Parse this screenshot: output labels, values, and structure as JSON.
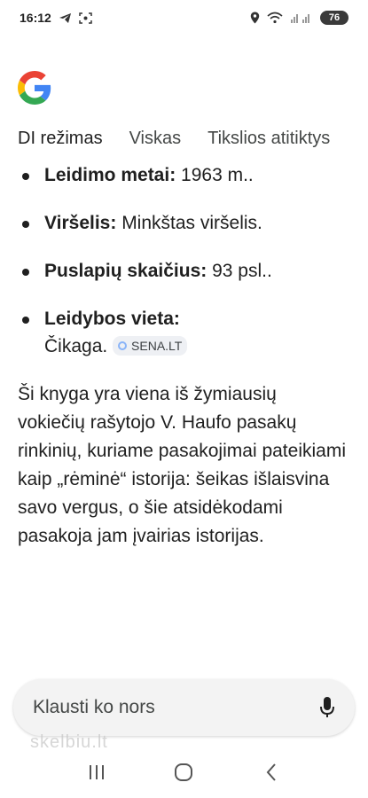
{
  "status_bar": {
    "time": "16:12",
    "battery": "76",
    "icons": [
      "telegram-icon",
      "screenshot-icon",
      "location-icon",
      "wifi-icon",
      "signal-icon",
      "battery-icon"
    ]
  },
  "app": {
    "logo": "google-logo"
  },
  "tabs": [
    {
      "label": "DI režimas",
      "active": true
    },
    {
      "label": "Viskas",
      "active": false
    },
    {
      "label": "Tikslios atitiktys",
      "active": false
    }
  ],
  "details": [
    {
      "label": "Leidimo metai:",
      "value": "1963 m.."
    },
    {
      "label": "Viršelis:",
      "value": "Minkštas viršelis."
    },
    {
      "label": "Puslapių skaičius:",
      "value": "93 psl.."
    },
    {
      "label": "Leidybos vieta:",
      "value": "Čikaga.",
      "source_chip": "SENA.LT"
    }
  ],
  "paragraph": "Ši knyga yra viena iš žymiausių vokiečių rašytojo V. Haufo pasakų rinkinių, kuriame pasakojimai pateikiami kaip „rėminė“ istorija: šeikas išlaisvina savo vergus, o šie atsidėkodami pasakoja jam įvairias istorijas.",
  "ask_bar": {
    "placeholder": "Klausti ko nors",
    "icon": "mic-icon"
  },
  "watermark": "skelbiu.lt",
  "nav": {
    "icons": [
      "recent-apps-icon",
      "home-icon",
      "back-icon"
    ]
  },
  "colors": {
    "google_blue": "#4285F4",
    "google_red": "#EA4335",
    "google_yellow": "#FBBC05",
    "google_green": "#34A853"
  }
}
